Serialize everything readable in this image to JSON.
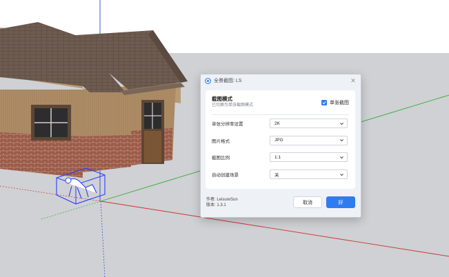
{
  "dialog": {
    "title": "全景截图: LS",
    "mode_title": "截图模式",
    "mode_subtitle": "已切换为单张截图模式",
    "single_checkbox_label": "单张截图",
    "single_checked": true,
    "settings": [
      {
        "label": "单张分辨率设置",
        "value": "2K"
      },
      {
        "label": "图片格式",
        "value": "JPG"
      },
      {
        "label": "截图比例",
        "value": "1:1"
      },
      {
        "label": "自动创建场景",
        "value": "关"
      }
    ],
    "author": "作者: LeisureSun",
    "version": "版本: 1.3.1",
    "cancel_label": "取消",
    "ok_label": "好"
  },
  "colors": {
    "accent": "#2f7cf0",
    "sky": "#ffffff",
    "ground": "#cfd1d4",
    "axis_red": "#cc3333",
    "axis_green": "#33aa33",
    "axis_blue": "#3344cc",
    "roof": "#6b5a4e",
    "wall": "#a98a66",
    "brick": "#9a5544"
  },
  "icons": {
    "app": "app-logo-icon",
    "close": "close-icon",
    "check": "check-icon",
    "dropdown": "chevron-down-icon"
  }
}
